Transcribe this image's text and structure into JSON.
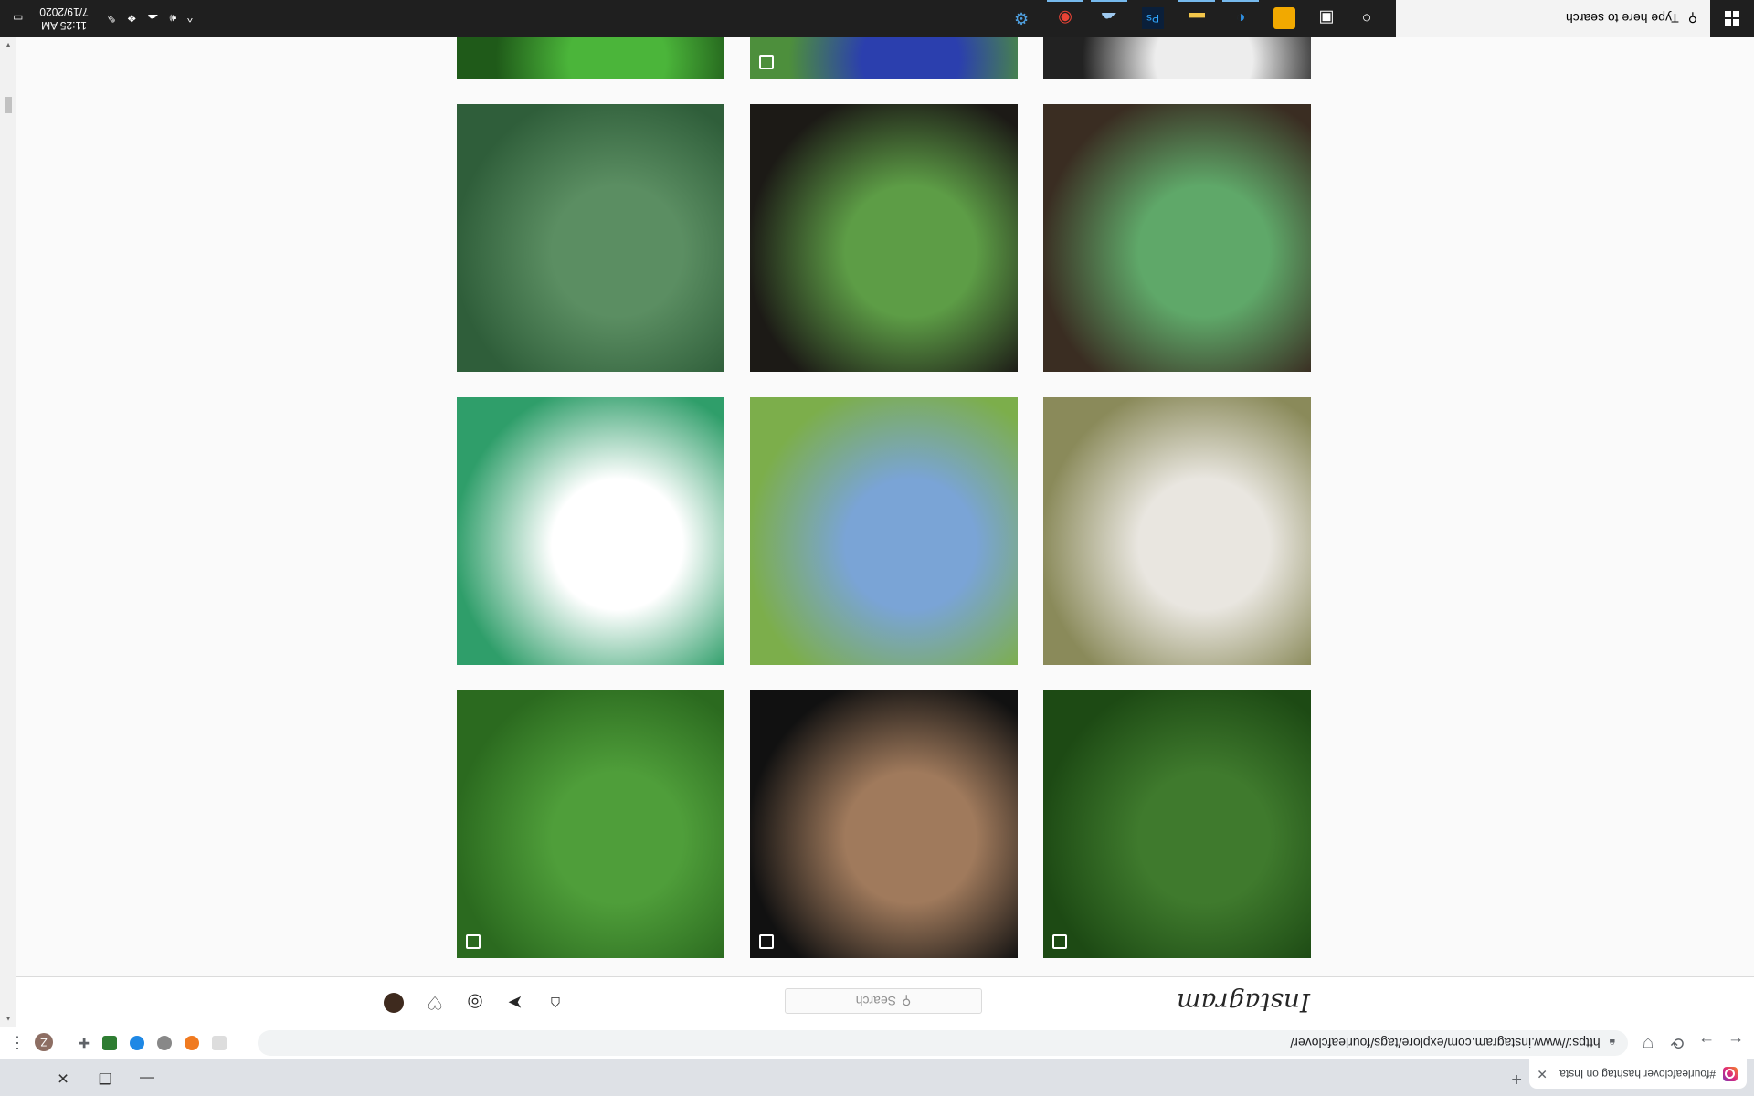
{
  "browser": {
    "tab_title": "#fourleafclover hashtag on Insta",
    "tab_close": "✕",
    "new_tab": "+",
    "url": "https://www.instagram.com/explore/tags/fourleafclover/",
    "back": "←",
    "forward": "→",
    "reload": "⟳",
    "profile_initial": "Z",
    "menu": "⋮",
    "win_min": "—",
    "win_restore": "❐",
    "win_close": "✕"
  },
  "instagram": {
    "logo": "Instagram",
    "search_placeholder": "Search",
    "search_icon": "⚲"
  },
  "grid": {
    "tiles": [
      {
        "subject": "monstera-leaf",
        "multi": true,
        "colors": [
          "#3f7a2d",
          "#1d4a14"
        ]
      },
      {
        "subject": "person-neck",
        "multi": true,
        "colors": [
          "#a07a5c",
          "#111111"
        ]
      },
      {
        "subject": "clover-patch",
        "multi": true,
        "colors": [
          "#4f9e3a",
          "#2b6a1f"
        ]
      },
      {
        "subject": "white-dog-with-clover",
        "multi": false,
        "colors": [
          "#e9e6e0",
          "#8a8a5a"
        ]
      },
      {
        "subject": "hand-holding-clover-lake",
        "multi": false,
        "colors": [
          "#7aa4d6",
          "#7cae4b"
        ]
      },
      {
        "subject": "clover-wire-jewelry",
        "multi": false,
        "colors": [
          "#ffffff",
          "#2f9e6a"
        ]
      },
      {
        "subject": "clover-leaves-soil",
        "multi": false,
        "colors": [
          "#5fa869",
          "#3a2d22"
        ]
      },
      {
        "subject": "clover-in-dark-soil",
        "multi": false,
        "colors": [
          "#5d9d46",
          "#1c1a16"
        ]
      },
      {
        "subject": "clover-john-deere",
        "multi": false,
        "colors": [
          "#5b8e62",
          "#2f5e3a"
        ]
      },
      {
        "subject": "bracelet-cards",
        "multi": false,
        "colors": [
          "#ededed",
          "#222222"
        ]
      },
      {
        "subject": "clover-painting",
        "multi": true,
        "colors": [
          "#2b3fae",
          "#4d8f3c"
        ]
      },
      {
        "subject": "clover-grass",
        "multi": false,
        "colors": [
          "#4bb53a",
          "#1f5a19"
        ]
      }
    ]
  },
  "taskbar": {
    "search_placeholder": "Type here to search",
    "time": "11:25 AM",
    "date": "7/19/2020"
  },
  "colors": {
    "accent_blue": "#76b9ed",
    "ig_border": "#dbdbdb"
  }
}
